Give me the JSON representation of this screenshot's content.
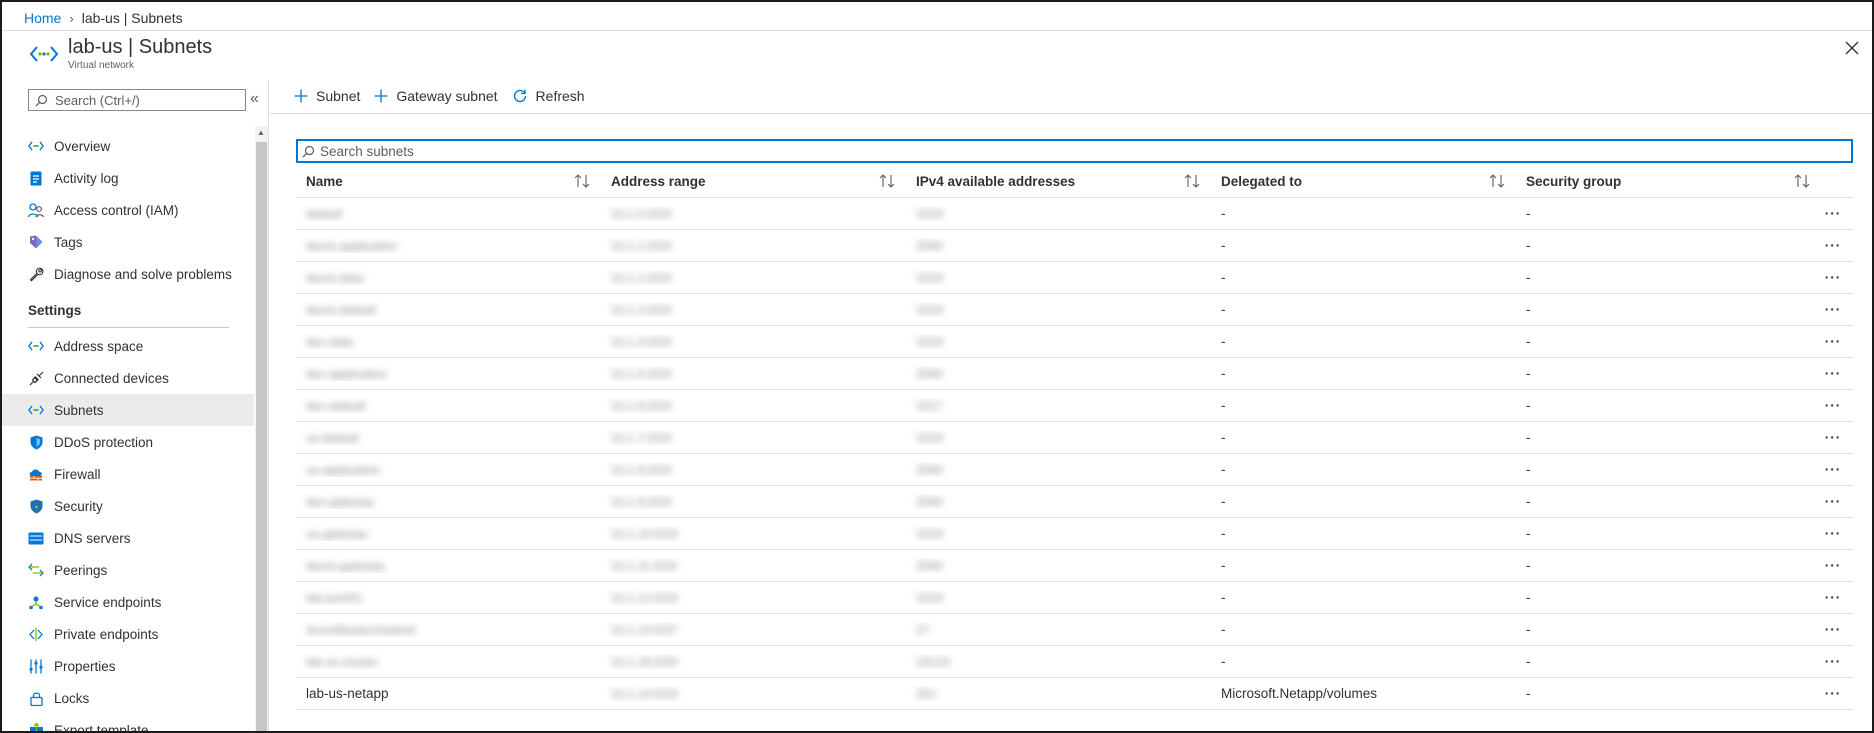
{
  "breadcrumb": {
    "home": "Home",
    "current": "lab-us | Subnets"
  },
  "header": {
    "title": "lab-us | Subnets",
    "subtitle": "Virtual network"
  },
  "sidebar": {
    "search_placeholder": "Search (Ctrl+/)",
    "top_items": [
      {
        "label": "Overview",
        "icon": "vnet-icon"
      },
      {
        "label": "Activity log",
        "icon": "activity-log-icon"
      },
      {
        "label": "Access control (IAM)",
        "icon": "people-icon"
      },
      {
        "label": "Tags",
        "icon": "tag-icon"
      },
      {
        "label": "Diagnose and solve problems",
        "icon": "wrench-icon"
      }
    ],
    "section": "Settings",
    "settings_items": [
      {
        "label": "Address space",
        "icon": "vnet-icon"
      },
      {
        "label": "Connected devices",
        "icon": "plug-icon"
      },
      {
        "label": "Subnets",
        "icon": "vnet-icon",
        "active": true
      },
      {
        "label": "DDoS protection",
        "icon": "shield-icon"
      },
      {
        "label": "Firewall",
        "icon": "firewall-icon"
      },
      {
        "label": "Security",
        "icon": "security-shield-icon"
      },
      {
        "label": "DNS servers",
        "icon": "dns-icon"
      },
      {
        "label": "Peerings",
        "icon": "peering-icon"
      },
      {
        "label": "Service endpoints",
        "icon": "service-endpoint-icon"
      },
      {
        "label": "Private endpoints",
        "icon": "private-endpoint-icon"
      },
      {
        "label": "Properties",
        "icon": "properties-icon"
      },
      {
        "label": "Locks",
        "icon": "lock-icon"
      },
      {
        "label": "Export template",
        "icon": "export-icon"
      }
    ]
  },
  "toolbar": {
    "subnet": "Subnet",
    "gateway_subnet": "Gateway subnet",
    "refresh": "Refresh"
  },
  "search_subnets_placeholder": "Search subnets",
  "table": {
    "columns": [
      "Name",
      "Address range",
      "IPv4 available addresses",
      "Delegated to",
      "Security group"
    ],
    "rows": [
      {
        "name": "default",
        "range": "10.1.0.0/24",
        "avail": "1019",
        "delegated": "-",
        "nsg": "-",
        "blurred": true
      },
      {
        "name": "demo-application",
        "range": "10.1.1.0/24",
        "avail": "2040",
        "delegated": "-",
        "nsg": "-",
        "blurred": true
      },
      {
        "name": "demo-data",
        "range": "10.1.2.0/24",
        "avail": "1019",
        "delegated": "-",
        "nsg": "-",
        "blurred": true
      },
      {
        "name": "demo-default",
        "range": "10.1.3.0/24",
        "avail": "1019",
        "delegated": "-",
        "nsg": "-",
        "blurred": true
      },
      {
        "name": "dev-data",
        "range": "10.1.4.0/24",
        "avail": "1019",
        "delegated": "-",
        "nsg": "-",
        "blurred": true
      },
      {
        "name": "dev-application",
        "range": "10.1.5.0/24",
        "avail": "2040",
        "delegated": "-",
        "nsg": "-",
        "blurred": true
      },
      {
        "name": "dev-default",
        "range": "10.1.6.0/24",
        "avail": "1017",
        "delegated": "-",
        "nsg": "-",
        "blurred": true
      },
      {
        "name": "us-default",
        "range": "10.1.7.0/24",
        "avail": "1019",
        "delegated": "-",
        "nsg": "-",
        "blurred": true
      },
      {
        "name": "us-application",
        "range": "10.1.8.0/24",
        "avail": "2040",
        "delegated": "-",
        "nsg": "-",
        "blurred": true
      },
      {
        "name": "dev-gateway",
        "range": "10.1.9.0/24",
        "avail": "2040",
        "delegated": "-",
        "nsg": "-",
        "blurred": true
      },
      {
        "name": "us-gateway",
        "range": "10.1.10.0/24",
        "avail": "1019",
        "delegated": "-",
        "nsg": "-",
        "blurred": true
      },
      {
        "name": "demo-gateway",
        "range": "10.1.11.0/24",
        "avail": "2040",
        "delegated": "-",
        "nsg": "-",
        "blurred": true
      },
      {
        "name": "lab-pool01",
        "range": "10.1.12.0/24",
        "avail": "1019",
        "delegated": "-",
        "nsg": "-",
        "blurred": true
      },
      {
        "name": "AzureBastionSubnet",
        "range": "10.1.13.0/27",
        "avail": "27",
        "delegated": "-",
        "nsg": "-",
        "blurred": true
      },
      {
        "name": "lab-us-cluster",
        "range": "10.1.16.0/20",
        "avail": "16123",
        "delegated": "-",
        "nsg": "-",
        "blurred": true
      },
      {
        "name": "lab-us-netapp",
        "range": "10.1.14.0/24",
        "avail": "251",
        "delegated": "Microsoft.Netapp/volumes",
        "nsg": "-",
        "blurred_partial": true
      }
    ]
  }
}
